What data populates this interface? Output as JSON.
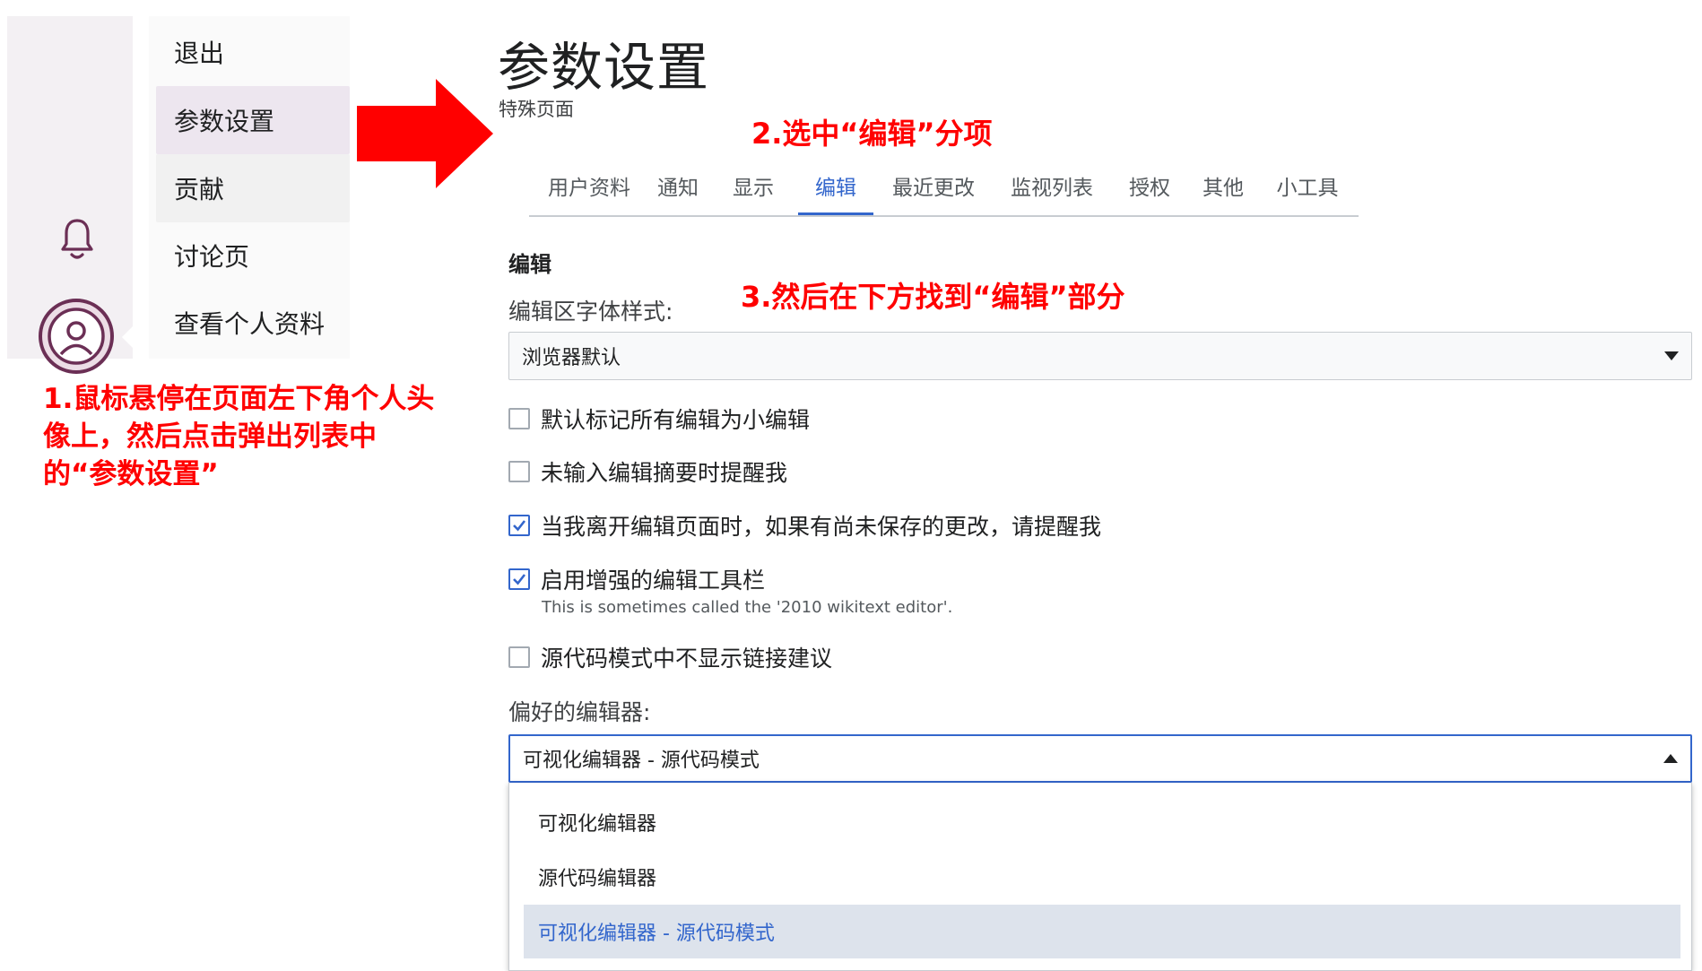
{
  "menu": {
    "items": [
      {
        "label": "退出",
        "state": "normal"
      },
      {
        "label": "参数设置",
        "state": "active"
      },
      {
        "label": "贡献",
        "state": "hover"
      },
      {
        "label": "讨论页",
        "state": "normal"
      },
      {
        "label": "查看个人资料",
        "state": "normal"
      }
    ]
  },
  "annotations": {
    "step1": "1.鼠标悬停在页面左下角个人头像上，然后点击弹出列表中的“参数设置”",
    "step2": "2.选中“编辑”分项",
    "step3": "3.然后在下方找到“编辑”部分"
  },
  "page": {
    "title": "参数设置",
    "subtitle": "特殊页面"
  },
  "tabs": [
    {
      "label": "用户资料",
      "active": false
    },
    {
      "label": "通知",
      "active": false
    },
    {
      "label": "显示",
      "active": false
    },
    {
      "label": "编辑",
      "active": true
    },
    {
      "label": "最近更改",
      "active": false
    },
    {
      "label": "监视列表",
      "active": false
    },
    {
      "label": "授权",
      "active": false
    },
    {
      "label": "其他",
      "active": false
    },
    {
      "label": "小工具",
      "active": false
    }
  ],
  "editing": {
    "heading": "编辑",
    "font_label": "编辑区字体样式:",
    "font_value": "浏览器默认",
    "checkboxes": [
      {
        "label": "默认标记所有编辑为小编辑",
        "checked": false
      },
      {
        "label": "未输入编辑摘要时提醒我",
        "checked": false
      },
      {
        "label": "当我离开编辑页面时，如果有尚未保存的更改，请提醒我",
        "checked": true
      },
      {
        "label": "启用增强的编辑工具栏",
        "checked": true
      },
      {
        "label": "源代码模式中不显示链接建议",
        "checked": false
      }
    ],
    "toolbar_help": "This is sometimes called the '2010 wikitext editor'.",
    "editor_label": "偏好的编辑器:",
    "editor_value": "可视化编辑器 - 源代码模式",
    "editor_options": [
      {
        "label": "可视化编辑器",
        "selected": false
      },
      {
        "label": "源代码编辑器",
        "selected": false
      },
      {
        "label": "可视化编辑器 - 源代码模式",
        "selected": true
      }
    ]
  },
  "colors": {
    "accent": "#3366cc",
    "annotation": "#ff0000",
    "avatar": "#6b2f55"
  },
  "icons": {
    "bell": "bell-icon",
    "avatar": "user-avatar-icon",
    "dropdown_closed": "triangle-down-icon",
    "dropdown_open": "triangle-up-icon",
    "check": "checkmark-icon"
  }
}
